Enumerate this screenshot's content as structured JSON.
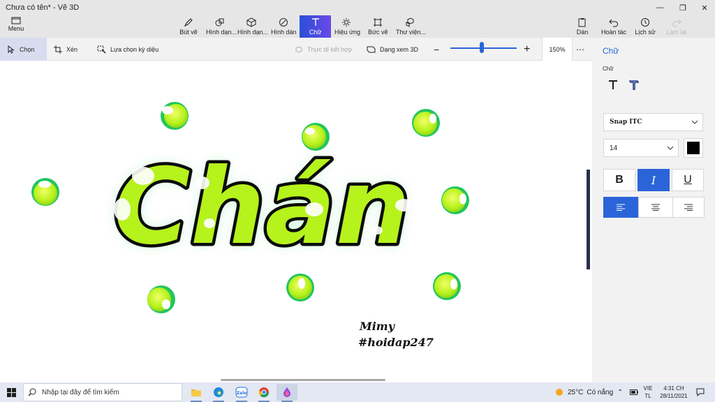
{
  "window": {
    "title": "Chưa có tên* - Vẽ 3D",
    "menu_label": "Menu"
  },
  "ribbon": {
    "tools": [
      {
        "label": "Bút vẽ",
        "icon": "brush-icon"
      },
      {
        "label": "Hình dạn...",
        "icon": "2d-shapes-icon"
      },
      {
        "label": "Hình dạn...",
        "icon": "3d-shapes-icon"
      },
      {
        "label": "Hình dán",
        "icon": "stickers-icon"
      },
      {
        "label": "Chữ",
        "icon": "text-icon",
        "active": true
      },
      {
        "label": "Hiệu ứng",
        "icon": "effects-icon"
      },
      {
        "label": "Bức vẽ",
        "icon": "canvas-icon"
      },
      {
        "label": "Thư viện...",
        "icon": "3d-library-icon"
      }
    ],
    "right_tools": [
      {
        "label": "Dán",
        "icon": "paste-icon"
      },
      {
        "label": "Hoàn tác",
        "icon": "undo-icon"
      },
      {
        "label": "Lịch sử",
        "icon": "history-icon"
      },
      {
        "label": "Làm lại",
        "icon": "redo-icon",
        "disabled": true
      }
    ]
  },
  "toolbar": {
    "select_label": "Chọn",
    "crop_label": "Xén",
    "magic_select_label": "Lựa chọn kỳ diệu",
    "mixed_reality_label": "Thực tế kết hợp",
    "view3d_label": "Dạng xem 3D",
    "zoom_value": "150%",
    "zoom_fraction": 0.47
  },
  "artwork": {
    "main_text": "Chán",
    "signature_line1": "Mimy",
    "signature_line2": "#hoidap247",
    "colors": {
      "fill": "#b6f21c",
      "outline": "#0c0c0c",
      "glow": "#8be8a8",
      "dot_ring": "#22c55e"
    }
  },
  "panel": {
    "title": "Chữ",
    "subtitle": "Chữ",
    "font_name": "Snap ITC",
    "font_size": "14",
    "text_color": "#000000",
    "bold_label": "B",
    "italic_label": "I",
    "underline_label": "U",
    "italic_active": true,
    "align_active": "left",
    "accent": "#2a64d8"
  },
  "taskbar": {
    "search_placeholder": "Nhập tại đây để tìm kiếm",
    "weather_temp": "25°C",
    "weather_text": "Có nắng",
    "lang_top": "VIE",
    "lang_bottom": "TL",
    "time": "4:31 CH",
    "date": "28/11/2021"
  }
}
